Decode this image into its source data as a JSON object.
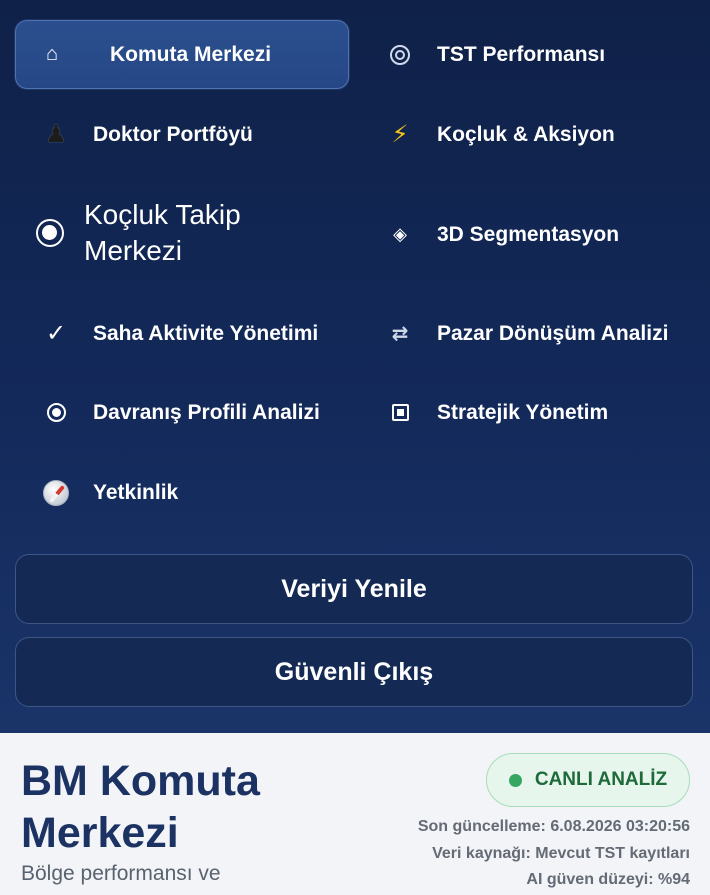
{
  "nav": {
    "items": [
      {
        "label": "Komuta Merkezi",
        "icon": "home-icon"
      },
      {
        "label": "TST Performansı",
        "icon": "target-icon"
      },
      {
        "label": "Doktor Portföyü",
        "icon": "chess-pawn-icon"
      },
      {
        "label": "Koçluk & Aksiyon",
        "icon": "lightning-icon"
      },
      {
        "label": "Koçluk Takip Merkezi",
        "icon": "radio-dot-icon"
      },
      {
        "label": "3D Segmentasyon",
        "icon": "diamond-icon"
      },
      {
        "label": "Saha Aktivite Yönetimi",
        "icon": "checkmark-icon"
      },
      {
        "label": "Pazar Dönüşüm Analizi",
        "icon": "swap-arrows-icon"
      },
      {
        "label": "Davranış Profili Analizi",
        "icon": "radio-dot-icon"
      },
      {
        "label": "Stratejik Yönetim",
        "icon": "square-button-icon"
      },
      {
        "label": "Yetkinlik",
        "icon": "compass-icon"
      }
    ],
    "active_index": 0
  },
  "actions": {
    "refresh_label": "Veriyi Yenile",
    "logout_label": "Güvenli Çıkış"
  },
  "header": {
    "title": "BM Komuta Merkezi",
    "subtitle": "Bölge performansı ve",
    "live_badge": "CANLI ANALİZ",
    "last_update": "Son güncelleme: 6.08.2026 03:20:56",
    "data_source": "Veri kaynağı: Mevcut TST kayıtları",
    "ai_confidence": "AI güven düzeyi: %94"
  },
  "colors": {
    "menu_bg": "#13295a",
    "active_item_bg": "#264785",
    "title": "#1b3262",
    "live_green": "#35a763"
  }
}
